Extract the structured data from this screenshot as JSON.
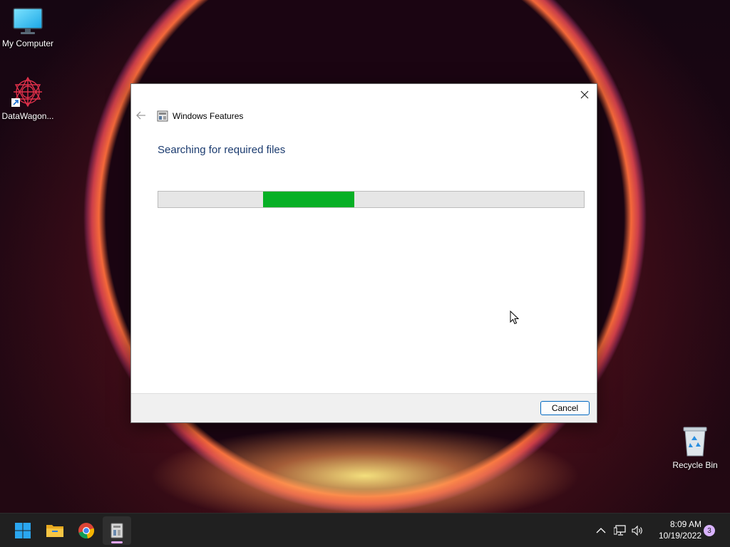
{
  "desktop": {
    "icons": [
      {
        "label": "My Computer",
        "icon": "monitor-icon"
      },
      {
        "label": "DataWagon...",
        "icon": "datawagon-shortcut-icon"
      },
      {
        "label": "Recycle Bin",
        "icon": "recycle-bin-icon"
      }
    ]
  },
  "dialog": {
    "title": "Windows Features",
    "heading": "Searching for required files",
    "progress": {
      "indeterminate_segment_start": 0.247,
      "indeterminate_segment_end": 0.46,
      "color": "#06b025"
    },
    "cancel_label": "Cancel"
  },
  "taskbar": {
    "apps": [
      {
        "name": "Start",
        "icon": "windows-start-icon"
      },
      {
        "name": "File Explorer",
        "icon": "folder-icon"
      },
      {
        "name": "Chrome",
        "icon": "chrome-icon"
      },
      {
        "name": "Windows Features",
        "icon": "windows-features-icon",
        "active": true
      }
    ],
    "tray": {
      "time": "8:09 AM",
      "date": "10/19/2022",
      "notifications": "3"
    }
  },
  "colors": {
    "accent": "#0067c0",
    "heading": "#1b3b6f",
    "progress": "#06b025",
    "taskbar": "#202020"
  }
}
